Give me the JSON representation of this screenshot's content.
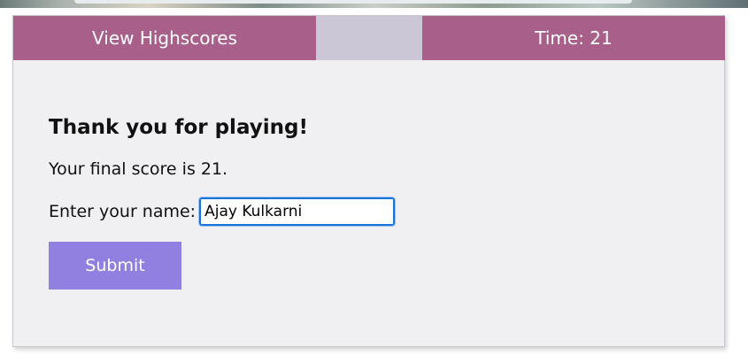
{
  "header": {
    "highscores_label": "View Highscores",
    "timer_label": "Time: 21"
  },
  "main": {
    "heading": "Thank you for playing!",
    "score_text": "Your final score is 21.",
    "name_label": "Enter your name:",
    "name_value": "Ajay Kulkarni",
    "submit_label": "Submit"
  },
  "colors": {
    "header": "#a85f89",
    "header_gap": "#cbc7d6",
    "card_background": "#f0eff2",
    "submit_button": "#9280e0",
    "input_focus_border": "#1a73d9"
  }
}
